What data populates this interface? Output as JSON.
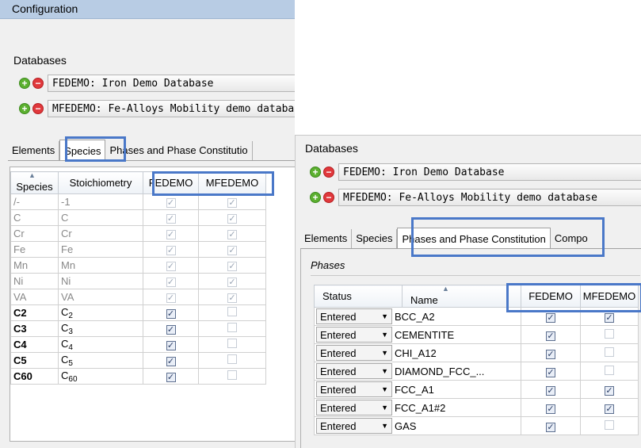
{
  "left": {
    "title": "Configuration",
    "databases_label": "Databases",
    "databases": [
      {
        "name": "FEDEMO: Iron Demo Database"
      },
      {
        "name": "MFEDEMO: Fe-Alloys Mobility demo database"
      }
    ],
    "tabs": [
      "Elements",
      "Species",
      "Phases and Phase Constitutio"
    ],
    "columns": [
      "Species",
      "Stoichiometry",
      "FEDEMO",
      "MFEDEMO"
    ],
    "rows": [
      {
        "species": "/-",
        "stoich": "-1",
        "fedemo": true,
        "mfedemo": true,
        "grey": true
      },
      {
        "species": "C",
        "stoich": "C",
        "fedemo": true,
        "mfedemo": true,
        "grey": true
      },
      {
        "species": "Cr",
        "stoich": "Cr",
        "fedemo": true,
        "mfedemo": true,
        "grey": true
      },
      {
        "species": "Fe",
        "stoich": "Fe",
        "fedemo": true,
        "mfedemo": true,
        "grey": true
      },
      {
        "species": "Mn",
        "stoich": "Mn",
        "fedemo": true,
        "mfedemo": true,
        "grey": true
      },
      {
        "species": "Ni",
        "stoich": "Ni",
        "fedemo": true,
        "mfedemo": true,
        "grey": true
      },
      {
        "species": "VA",
        "stoich": "VA",
        "fedemo": true,
        "mfedemo": true,
        "grey": true
      },
      {
        "species": "C2",
        "stoich": "C",
        "sub": "2",
        "fedemo": true,
        "mfedemo": false,
        "grey": false
      },
      {
        "species": "C3",
        "stoich": "C",
        "sub": "3",
        "fedemo": true,
        "mfedemo": false,
        "grey": false
      },
      {
        "species": "C4",
        "stoich": "C",
        "sub": "4",
        "fedemo": true,
        "mfedemo": false,
        "grey": false
      },
      {
        "species": "C5",
        "stoich": "C",
        "sub": "5",
        "fedemo": true,
        "mfedemo": false,
        "grey": false
      },
      {
        "species": "C60",
        "stoich": "C",
        "sub": "60",
        "fedemo": true,
        "mfedemo": false,
        "grey": false
      }
    ]
  },
  "right": {
    "databases_label": "Databases",
    "databases": [
      {
        "name": "FEDEMO: Iron Demo Database"
      },
      {
        "name": "MFEDEMO: Fe-Alloys Mobility demo database"
      }
    ],
    "tabs": [
      "Elements",
      "Species",
      "Phases and Phase Constitution",
      "Compo"
    ],
    "phases_label": "Phases",
    "columns": [
      "Status",
      "Name",
      "FEDEMO",
      "MFEDEMO"
    ],
    "rows": [
      {
        "status": "Entered",
        "name": "BCC_A2",
        "fedemo": true,
        "mfedemo": true
      },
      {
        "status": "Entered",
        "name": "CEMENTITE",
        "fedemo": true,
        "mfedemo": false
      },
      {
        "status": "Entered",
        "name": "CHI_A12",
        "fedemo": true,
        "mfedemo": false
      },
      {
        "status": "Entered",
        "name": "DIAMOND_FCC_...",
        "fedemo": true,
        "mfedemo": false
      },
      {
        "status": "Entered",
        "name": "FCC_A1",
        "fedemo": true,
        "mfedemo": true
      },
      {
        "status": "Entered",
        "name": "FCC_A1#2",
        "fedemo": true,
        "mfedemo": true
      },
      {
        "status": "Entered",
        "name": "GAS",
        "fedemo": true,
        "mfedemo": false
      }
    ]
  },
  "icons": {
    "add": "add-circle-icon",
    "remove": "remove-circle-icon",
    "check": "checkmark-icon",
    "sort": "sort-ascending-icon",
    "dropdown": "dropdown-arrow-icon"
  },
  "colors": {
    "highlight": "#4a78c8",
    "title_bar": "#b8cce4"
  }
}
